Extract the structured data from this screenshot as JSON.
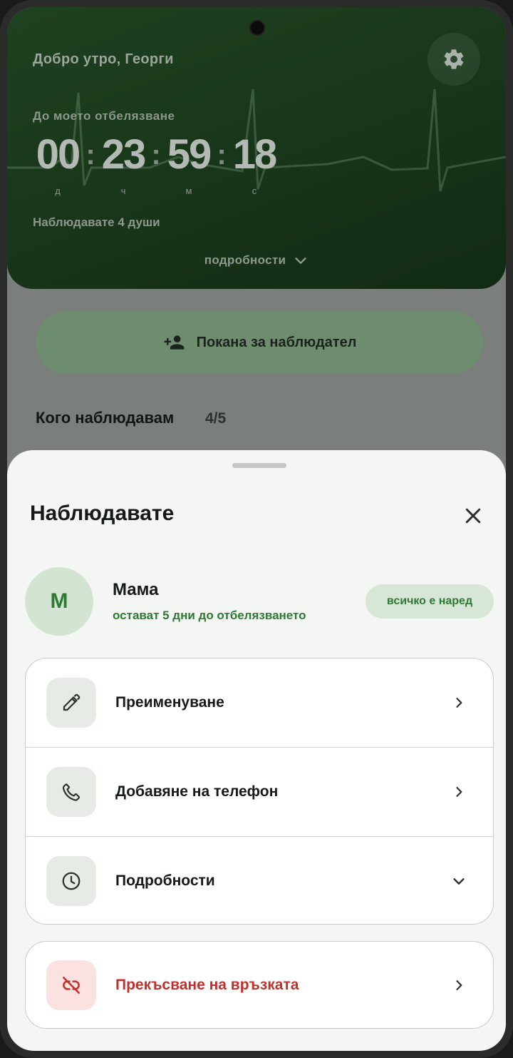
{
  "header": {
    "greeting": "Добро утро, Георги",
    "countdown_label": "До моето отбелязване",
    "countdown": [
      {
        "value": "00",
        "unit": "д"
      },
      {
        "value": "23",
        "unit": "ч"
      },
      {
        "value": "59",
        "unit": "м"
      },
      {
        "value": "18",
        "unit": "с"
      }
    ],
    "watching_text": "Наблюдавате 4 души",
    "details_label": "подробности",
    "settings_icon": "gear-icon"
  },
  "invite_button": {
    "label": "Покана за наблюдател",
    "icon": "person-add-icon"
  },
  "section": {
    "title": "Кого наблюдавам",
    "count": "4/5"
  },
  "sheet": {
    "title": "Наблюдавате",
    "contact": {
      "initial": "М",
      "name": "Мама",
      "subtitle": "остават 5 дни до отбелязването",
      "status": "всичко е наред"
    },
    "menu": [
      {
        "label": "Преименуване",
        "icon": "pencil-icon"
      },
      {
        "label": "Добавяне на телефон",
        "icon": "phone-icon"
      },
      {
        "label": "Подробности",
        "icon": "clock-icon"
      }
    ],
    "danger": {
      "label": "Прекъсване на връзката",
      "icon": "link-off-icon"
    }
  },
  "colors": {
    "accent_green": "#2f7a33",
    "danger_red": "#c3302c",
    "header_bg": "#1f4220"
  }
}
